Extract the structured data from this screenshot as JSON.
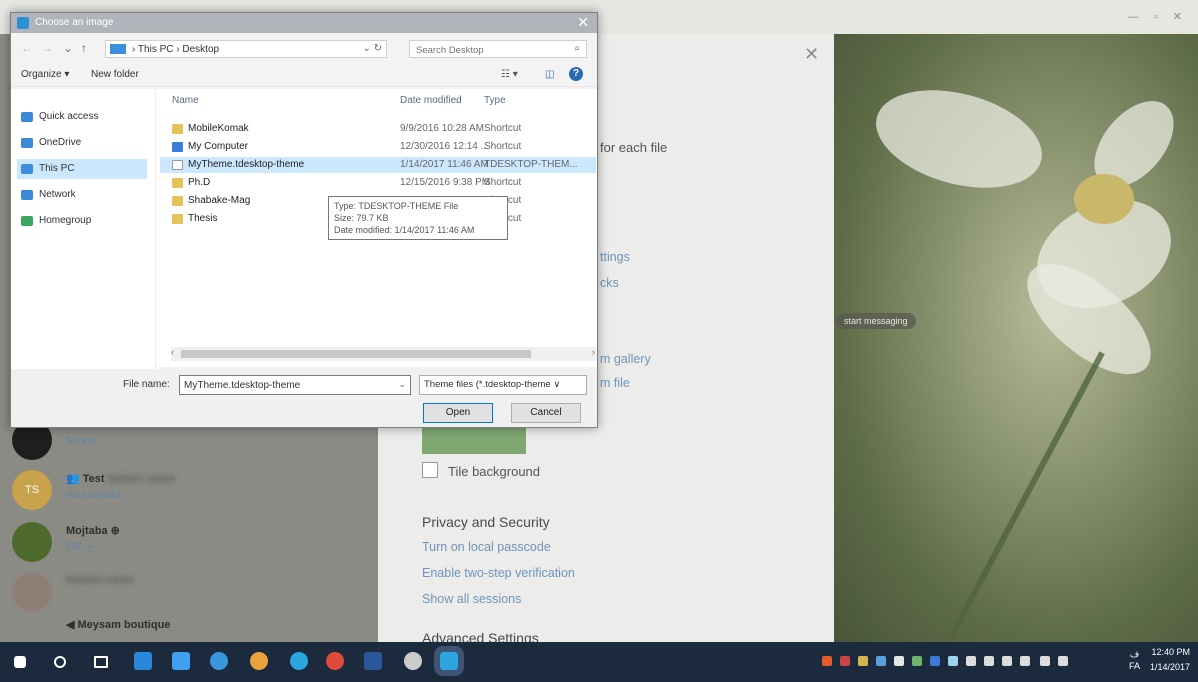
{
  "dialog": {
    "title": "Choose an image",
    "close_glyph": "✕",
    "breadcrumb": "› This PC › Desktop",
    "search_placeholder": "Search Desktop",
    "organize_label": "Organize ▾",
    "new_folder_label": "New folder",
    "nav_items": [
      {
        "label": "Quick access",
        "icon": "star-icon",
        "color": "#3b8ad9"
      },
      {
        "label": "OneDrive",
        "icon": "cloud-icon",
        "color": "#3b8ad9"
      },
      {
        "label": "This PC",
        "icon": "computer-icon",
        "color": "#3d8fde"
      },
      {
        "label": "Network",
        "icon": "network-icon",
        "color": "#3b8ad9"
      },
      {
        "label": "Homegroup",
        "icon": "homegroup-icon",
        "color": "#3aa760"
      }
    ],
    "columns": {
      "name": "Name",
      "date": "Date modified",
      "type": "Type"
    },
    "files": [
      {
        "name": "MobileKomak",
        "date": "9/9/2016 10:28 AM",
        "type": "Shortcut"
      },
      {
        "name": "My Computer",
        "date": "12/30/2016 12:14 ...",
        "type": "Shortcut"
      },
      {
        "name": "MyTheme.tdesktop-theme",
        "date": "1/14/2017 11:46 AM",
        "type": "TDESKTOP-THEM..."
      },
      {
        "name": "Ph.D",
        "date": "12/15/2016 9:38 PM",
        "type": "Shortcut"
      },
      {
        "name": "Shabake-Mag",
        "date": "",
        "type": "Shortcut"
      },
      {
        "name": "Thesis",
        "date": "",
        "type": "Shortcut"
      }
    ],
    "tooltip": {
      "line1": "Type: TDESKTOP-THEME File",
      "line2": "Size: 79.7 KB",
      "line3": "Date modified: 1/14/2017 11:46 AM"
    },
    "file_name_label": "File name:",
    "file_name_value": "MyTheme.tdesktop-theme",
    "file_type_value": "Theme files (*.tdesktop-theme ∨",
    "open_label": "Open",
    "cancel_label": "Cancel"
  },
  "settings": {
    "close_glyph": "✕",
    "fragments": {
      "for_each_file": "for each file",
      "ttings": "ttings",
      "cks": "cks",
      "m_gallery": "m gallery",
      "m_file": "m file"
    },
    "tile_background": "Tile background",
    "privacy_header": "Privacy and Security",
    "privacy_links": [
      "Turn on local passcode",
      "Enable two-step verification",
      "Show all sessions"
    ],
    "advanced_header": "Advanced Settings"
  },
  "wallpaper": {
    "start_messaging": "start messaging"
  },
  "chats": [
    {
      "name": "",
      "sub": "Sticker",
      "avatar_color": "#1e1e1e"
    },
    {
      "name": "Test",
      "sub": "Your contact",
      "avatar_color": "#c9a24c",
      "avatar_text": "TS"
    },
    {
      "name": "Mojtaba ⊕",
      "sub": "GIF, ج",
      "avatar_color": "#4d6a2c"
    },
    {
      "name": "",
      "sub": "",
      "avatar_color": "#8e7f76"
    },
    {
      "name": "Meysam boutique",
      "sub": "",
      "avatar_color": "#555"
    }
  ],
  "taskbar": {
    "time": "12:40 PM",
    "date": "1/14/2017",
    "lang": "FA",
    "apps": [
      {
        "icon": "windows-start-icon",
        "color": "#ffffff"
      },
      {
        "icon": "search-icon",
        "color": "#ffffff"
      },
      {
        "icon": "task-view-icon",
        "color": "#ffffff"
      },
      {
        "icon": "file-explorer-icon",
        "color": "#2b88d8"
      },
      {
        "icon": "photos-icon",
        "color": "#41a0f0"
      },
      {
        "icon": "app-icon",
        "color": "#3a96dd"
      },
      {
        "icon": "browser-icon",
        "color": "#e8a33d"
      },
      {
        "icon": "telegram-icon",
        "color": "#2ca5e0"
      },
      {
        "icon": "chrome-icon",
        "color": "#e04a3a"
      },
      {
        "icon": "word-icon",
        "color": "#2b579a"
      },
      {
        "icon": "tool-icon",
        "color": "#cccccc"
      },
      {
        "icon": "telegram-active-icon",
        "color": "#2ca5e0"
      }
    ]
  }
}
